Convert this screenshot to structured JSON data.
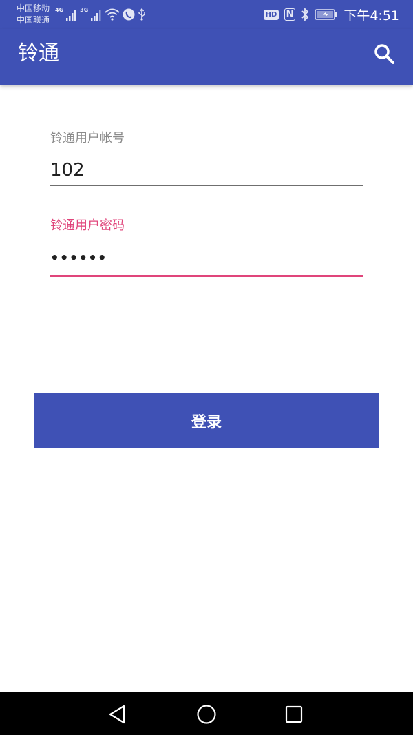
{
  "status_bar": {
    "carrier_1": "中国移动",
    "carrier_2": "中国联通",
    "network_1": "4G",
    "network_2": "3G",
    "hd_label": "HD",
    "nfc_label": "N",
    "time": "下午4:51"
  },
  "app_bar": {
    "title": "铃通",
    "search_icon": "search-icon"
  },
  "form": {
    "account_label": "铃通用户帐号",
    "account_value": "102",
    "password_label": "铃通用户密码",
    "password_value": "••••••"
  },
  "login_button": {
    "label": "登录"
  },
  "nav_bar": {
    "back_icon": "back-icon",
    "home_icon": "home-icon",
    "recent_icon": "recent-apps-icon"
  },
  "colors": {
    "primary": "#3f51b5",
    "accent": "#e0457b",
    "hint_gray": "#8a8a8a"
  }
}
